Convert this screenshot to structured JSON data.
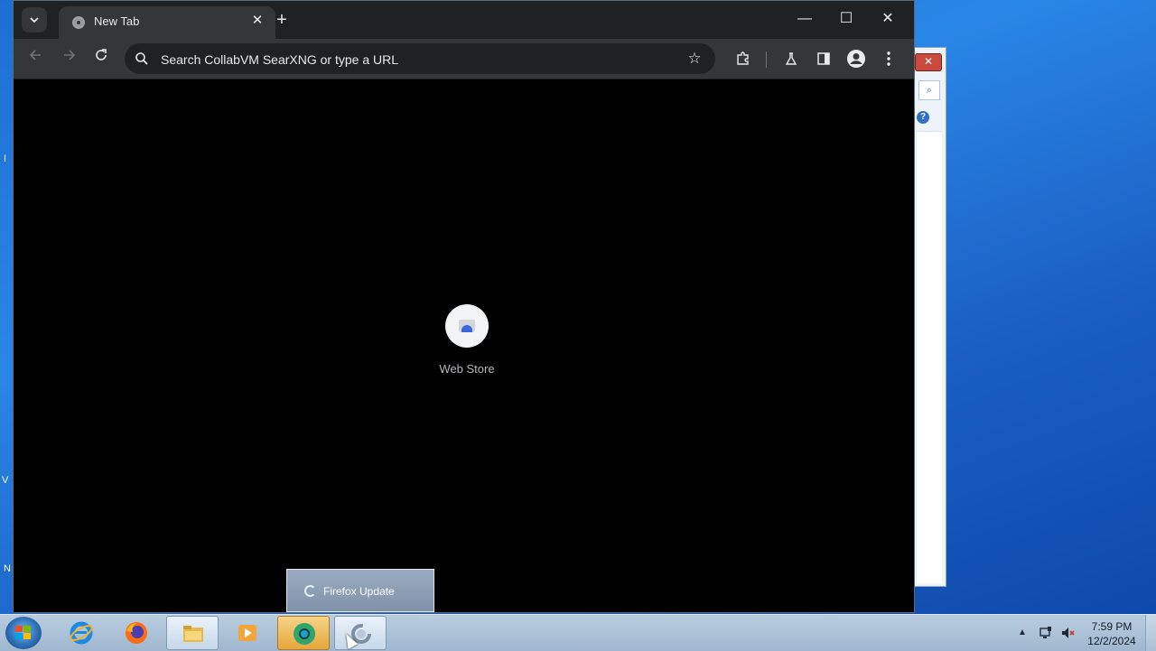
{
  "desktop": {
    "edge_glyphs": [
      "I",
      "V",
      "N"
    ]
  },
  "browser": {
    "tab": {
      "title": "New Tab",
      "close_glyph": "✕"
    },
    "new_tab_glyph": "+",
    "window_controls": {
      "minimize": "—",
      "maximize": "☐",
      "close": "✕"
    },
    "omnibox": {
      "placeholder": "Search CollabVM SearXNG or type a URL"
    },
    "icons": [
      "tab-list",
      "back",
      "forward",
      "reload",
      "search",
      "bookmark-star",
      "extensions",
      "labs-flask",
      "side-panel",
      "profile",
      "menu"
    ],
    "shortcut": {
      "label": "Web Store"
    }
  },
  "background_window": {
    "close_glyph": "✕",
    "help_glyph": "?"
  },
  "taskbar": {
    "popup": {
      "label": "Firefox Update"
    },
    "apps": [
      "internet-explorer",
      "firefox",
      "file-explorer",
      "media-player",
      "chrome",
      "firefox-update"
    ],
    "clock": {
      "time": "7:59 PM",
      "date": "12/2/2024"
    }
  }
}
